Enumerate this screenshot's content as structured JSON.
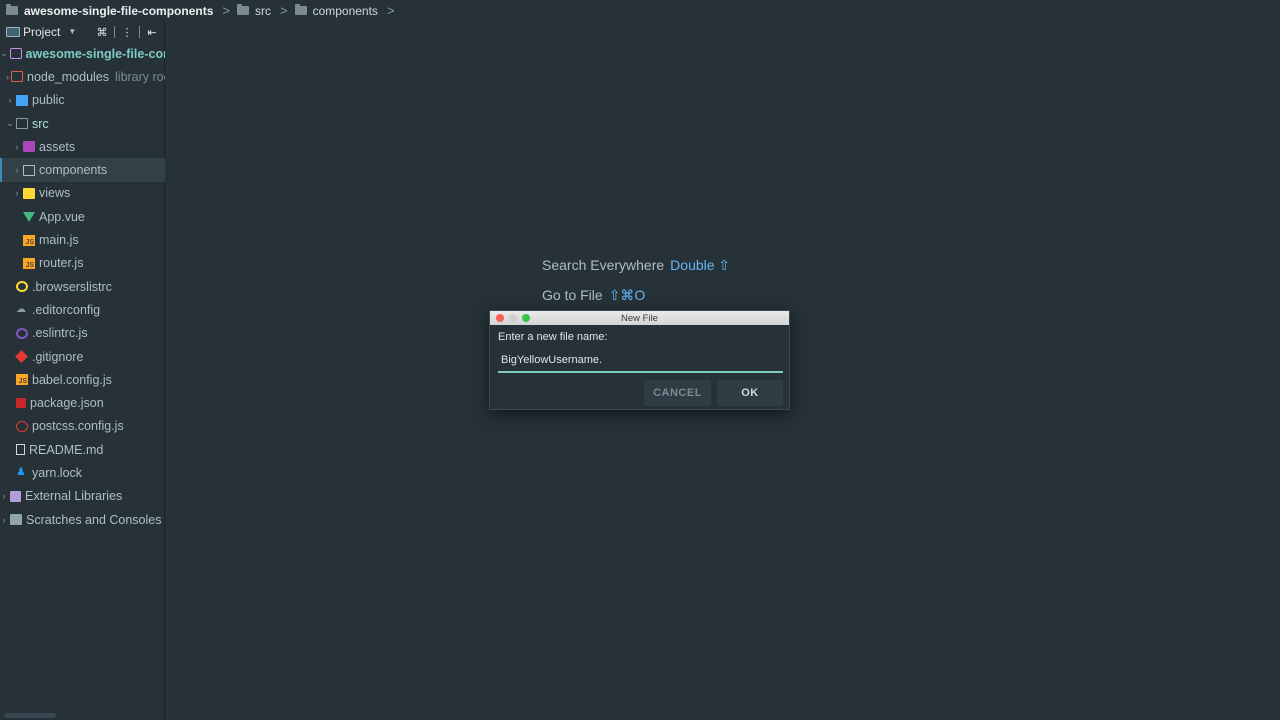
{
  "breadcrumb": [
    "awesome-single-file-components",
    "src",
    "components"
  ],
  "panel": {
    "title": "Project",
    "tools": [
      "collapse-all",
      "options",
      "hide"
    ]
  },
  "tree": [
    {
      "label": "awesome-single-file-con",
      "arrow": "open",
      "icon": "root",
      "indent": 0,
      "style": "root",
      "name": "tree-item-root"
    },
    {
      "label": "node_modules",
      "hint": "library roo",
      "arrow": "closed",
      "icon": "folder-red",
      "indent": 1,
      "name": "tree-item-node-modules"
    },
    {
      "label": "public",
      "arrow": "closed",
      "icon": "folder-blue",
      "indent": 1,
      "name": "tree-item-public"
    },
    {
      "label": "src",
      "arrow": "open",
      "icon": "folder",
      "indent": 1,
      "style": "src",
      "name": "tree-item-src"
    },
    {
      "label": "assets",
      "arrow": "closed",
      "icon": "folder-purple",
      "indent": 2,
      "name": "tree-item-assets"
    },
    {
      "label": "components",
      "arrow": "closed",
      "icon": "folder-outline",
      "indent": 2,
      "selected": true,
      "name": "tree-item-components"
    },
    {
      "label": "views",
      "arrow": "closed",
      "icon": "folder-yellow",
      "indent": 2,
      "name": "tree-item-views"
    },
    {
      "label": "App.vue",
      "arrow": "none",
      "icon": "vue",
      "indent": 2,
      "name": "tree-item-app-vue"
    },
    {
      "label": "main.js",
      "arrow": "none",
      "icon": "js",
      "indent": 2,
      "name": "tree-item-main-js"
    },
    {
      "label": "router.js",
      "arrow": "none",
      "icon": "js",
      "indent": 2,
      "name": "tree-item-router-js"
    },
    {
      "label": ".browserslistrc",
      "arrow": "none",
      "icon": "circle-yellow",
      "indent": 1,
      "name": "tree-item-browserslistrc"
    },
    {
      "label": ".editorconfig",
      "arrow": "none",
      "icon": "config",
      "indent": 1,
      "name": "tree-item-editorconfig"
    },
    {
      "label": ".eslintrc.js",
      "arrow": "none",
      "icon": "eslint",
      "indent": 1,
      "name": "tree-item-eslintrc"
    },
    {
      "label": ".gitignore",
      "arrow": "none",
      "icon": "git",
      "indent": 1,
      "name": "tree-item-gitignore"
    },
    {
      "label": "babel.config.js",
      "arrow": "none",
      "icon": "js",
      "indent": 1,
      "name": "tree-item-babel-config"
    },
    {
      "label": "package.json",
      "arrow": "none",
      "icon": "pkg",
      "indent": 1,
      "name": "tree-item-package-json"
    },
    {
      "label": "postcss.config.js",
      "arrow": "none",
      "icon": "postcss",
      "indent": 1,
      "name": "tree-item-postcss-config"
    },
    {
      "label": "README.md",
      "arrow": "none",
      "icon": "readme",
      "indent": 1,
      "name": "tree-item-readme"
    },
    {
      "label": "yarn.lock",
      "arrow": "none",
      "icon": "yarn",
      "indent": 1,
      "name": "tree-item-yarn-lock"
    },
    {
      "label": "External Libraries",
      "arrow": "closed",
      "icon": "lib",
      "indent": 0,
      "name": "tree-item-external-libraries"
    },
    {
      "label": "Scratches and Consoles",
      "arrow": "closed",
      "icon": "scratch",
      "indent": 0,
      "name": "tree-item-scratches"
    }
  ],
  "editor_hints": {
    "search_label": "Search Everywhere",
    "search_shortcut": "Double ⇧",
    "goto_label": "Go to File",
    "goto_shortcut": "⇧⌘O"
  },
  "dialog": {
    "title": "New File",
    "prompt": "Enter a new file name:",
    "value": "BigYellowUsername.",
    "cancel_label": "CANCEL",
    "ok_label": "OK"
  },
  "colors": {
    "background": "#263238",
    "accent": "#80cbc4",
    "shortcut": "#64b5f6"
  }
}
